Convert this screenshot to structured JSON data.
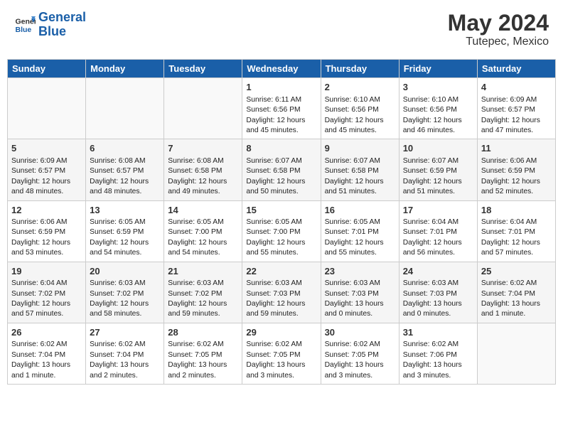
{
  "header": {
    "logo_general": "General",
    "logo_blue": "Blue",
    "main_title": "May 2024",
    "subtitle": "Tutepec, Mexico"
  },
  "days_of_week": [
    "Sunday",
    "Monday",
    "Tuesday",
    "Wednesday",
    "Thursday",
    "Friday",
    "Saturday"
  ],
  "weeks": [
    [
      {
        "day": "",
        "info": ""
      },
      {
        "day": "",
        "info": ""
      },
      {
        "day": "",
        "info": ""
      },
      {
        "day": "1",
        "info": "Sunrise: 6:11 AM\nSunset: 6:56 PM\nDaylight: 12 hours\nand 45 minutes."
      },
      {
        "day": "2",
        "info": "Sunrise: 6:10 AM\nSunset: 6:56 PM\nDaylight: 12 hours\nand 45 minutes."
      },
      {
        "day": "3",
        "info": "Sunrise: 6:10 AM\nSunset: 6:56 PM\nDaylight: 12 hours\nand 46 minutes."
      },
      {
        "day": "4",
        "info": "Sunrise: 6:09 AM\nSunset: 6:57 PM\nDaylight: 12 hours\nand 47 minutes."
      }
    ],
    [
      {
        "day": "5",
        "info": "Sunrise: 6:09 AM\nSunset: 6:57 PM\nDaylight: 12 hours\nand 48 minutes."
      },
      {
        "day": "6",
        "info": "Sunrise: 6:08 AM\nSunset: 6:57 PM\nDaylight: 12 hours\nand 48 minutes."
      },
      {
        "day": "7",
        "info": "Sunrise: 6:08 AM\nSunset: 6:58 PM\nDaylight: 12 hours\nand 49 minutes."
      },
      {
        "day": "8",
        "info": "Sunrise: 6:07 AM\nSunset: 6:58 PM\nDaylight: 12 hours\nand 50 minutes."
      },
      {
        "day": "9",
        "info": "Sunrise: 6:07 AM\nSunset: 6:58 PM\nDaylight: 12 hours\nand 51 minutes."
      },
      {
        "day": "10",
        "info": "Sunrise: 6:07 AM\nSunset: 6:59 PM\nDaylight: 12 hours\nand 51 minutes."
      },
      {
        "day": "11",
        "info": "Sunrise: 6:06 AM\nSunset: 6:59 PM\nDaylight: 12 hours\nand 52 minutes."
      }
    ],
    [
      {
        "day": "12",
        "info": "Sunrise: 6:06 AM\nSunset: 6:59 PM\nDaylight: 12 hours\nand 53 minutes."
      },
      {
        "day": "13",
        "info": "Sunrise: 6:05 AM\nSunset: 6:59 PM\nDaylight: 12 hours\nand 54 minutes."
      },
      {
        "day": "14",
        "info": "Sunrise: 6:05 AM\nSunset: 7:00 PM\nDaylight: 12 hours\nand 54 minutes."
      },
      {
        "day": "15",
        "info": "Sunrise: 6:05 AM\nSunset: 7:00 PM\nDaylight: 12 hours\nand 55 minutes."
      },
      {
        "day": "16",
        "info": "Sunrise: 6:05 AM\nSunset: 7:01 PM\nDaylight: 12 hours\nand 55 minutes."
      },
      {
        "day": "17",
        "info": "Sunrise: 6:04 AM\nSunset: 7:01 PM\nDaylight: 12 hours\nand 56 minutes."
      },
      {
        "day": "18",
        "info": "Sunrise: 6:04 AM\nSunset: 7:01 PM\nDaylight: 12 hours\nand 57 minutes."
      }
    ],
    [
      {
        "day": "19",
        "info": "Sunrise: 6:04 AM\nSunset: 7:02 PM\nDaylight: 12 hours\nand 57 minutes."
      },
      {
        "day": "20",
        "info": "Sunrise: 6:03 AM\nSunset: 7:02 PM\nDaylight: 12 hours\nand 58 minutes."
      },
      {
        "day": "21",
        "info": "Sunrise: 6:03 AM\nSunset: 7:02 PM\nDaylight: 12 hours\nand 59 minutes."
      },
      {
        "day": "22",
        "info": "Sunrise: 6:03 AM\nSunset: 7:03 PM\nDaylight: 12 hours\nand 59 minutes."
      },
      {
        "day": "23",
        "info": "Sunrise: 6:03 AM\nSunset: 7:03 PM\nDaylight: 13 hours\nand 0 minutes."
      },
      {
        "day": "24",
        "info": "Sunrise: 6:03 AM\nSunset: 7:03 PM\nDaylight: 13 hours\nand 0 minutes."
      },
      {
        "day": "25",
        "info": "Sunrise: 6:02 AM\nSunset: 7:04 PM\nDaylight: 13 hours\nand 1 minute."
      }
    ],
    [
      {
        "day": "26",
        "info": "Sunrise: 6:02 AM\nSunset: 7:04 PM\nDaylight: 13 hours\nand 1 minute."
      },
      {
        "day": "27",
        "info": "Sunrise: 6:02 AM\nSunset: 7:04 PM\nDaylight: 13 hours\nand 2 minutes."
      },
      {
        "day": "28",
        "info": "Sunrise: 6:02 AM\nSunset: 7:05 PM\nDaylight: 13 hours\nand 2 minutes."
      },
      {
        "day": "29",
        "info": "Sunrise: 6:02 AM\nSunset: 7:05 PM\nDaylight: 13 hours\nand 3 minutes."
      },
      {
        "day": "30",
        "info": "Sunrise: 6:02 AM\nSunset: 7:05 PM\nDaylight: 13 hours\nand 3 minutes."
      },
      {
        "day": "31",
        "info": "Sunrise: 6:02 AM\nSunset: 7:06 PM\nDaylight: 13 hours\nand 3 minutes."
      },
      {
        "day": "",
        "info": ""
      }
    ]
  ]
}
